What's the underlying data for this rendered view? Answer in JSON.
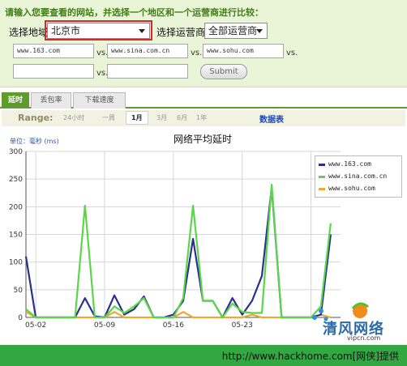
{
  "form": {
    "intro": "请输入您要查看的网站，并选择一个地区和一个运营商进行比较：",
    "region_label": "选择地域",
    "region_value": "北京市",
    "isp_label": "选择运营商：",
    "isp_value": "全部运营商",
    "sites": [
      "www.163.com",
      "www.sina.com.cn",
      "www.sohu.com",
      "",
      ""
    ],
    "vs_label": "vs.",
    "submit_label": "Submit"
  },
  "tabs": [
    {
      "label": "延时",
      "active": true
    },
    {
      "label": "丢包率",
      "active": false
    },
    {
      "label": "下载速度",
      "active": false
    }
  ],
  "range": {
    "label": "Range:",
    "options": [
      "24小时",
      "一周",
      "1月",
      "3月",
      "6月",
      "1年"
    ],
    "selected": "1月",
    "data_table_link": "数据表"
  },
  "chart": {
    "title": "网络平均延时",
    "unit_label": "单位：毫秒 (ms)"
  },
  "chart_data": {
    "type": "line",
    "title": "网络平均延时",
    "ylabel": "单位：毫秒 (ms)",
    "ylim": [
      0,
      300
    ],
    "yticks": [
      0,
      50,
      100,
      150,
      200,
      250,
      300
    ],
    "xlim": [
      0,
      32
    ],
    "xticks": [
      {
        "x": 1,
        "label": "05-02"
      },
      {
        "x": 8,
        "label": "05-09"
      },
      {
        "x": 15,
        "label": "05-16"
      },
      {
        "x": 22,
        "label": "05-23"
      },
      {
        "x": 29,
        "label": ""
      }
    ],
    "grid": true,
    "legend_position": "top-right",
    "series": [
      {
        "name": "www.163.com",
        "color": "#2b2f8f",
        "x": [
          0,
          1,
          2,
          3,
          4,
          5,
          6,
          7,
          8,
          9,
          10,
          11,
          12,
          13,
          14,
          15,
          16,
          17,
          18,
          19,
          20,
          21,
          22,
          23,
          24,
          25,
          26,
          27,
          28,
          29,
          30,
          31
        ],
        "values": [
          110,
          0,
          0,
          0,
          0,
          0,
          35,
          2,
          0,
          40,
          5,
          15,
          38,
          0,
          0,
          5,
          30,
          142,
          30,
          30,
          0,
          35,
          5,
          30,
          75,
          235,
          0,
          0,
          0,
          0,
          5,
          150
        ]
      },
      {
        "name": "www.sina.com.cn",
        "color": "#5ad64a",
        "x": [
          0,
          1,
          2,
          3,
          4,
          5,
          6,
          7,
          8,
          9,
          10,
          11,
          12,
          13,
          14,
          15,
          16,
          17,
          18,
          19,
          20,
          21,
          22,
          23,
          24,
          25,
          26,
          27,
          28,
          29,
          30,
          31
        ],
        "values": [
          15,
          0,
          0,
          0,
          0,
          0,
          202,
          0,
          0,
          20,
          8,
          20,
          35,
          0,
          0,
          0,
          35,
          202,
          30,
          30,
          0,
          25,
          10,
          8,
          8,
          240,
          0,
          0,
          0,
          0,
          20,
          170
        ]
      },
      {
        "name": "www.sohu.com",
        "color": "#f0a830",
        "x": [
          0,
          1,
          2,
          3,
          4,
          5,
          6,
          7,
          8,
          9,
          10,
          11,
          12,
          13,
          14,
          15,
          16,
          17,
          18,
          19,
          20,
          21,
          22,
          23,
          24,
          25,
          26,
          27,
          28,
          29,
          30,
          31
        ],
        "values": [
          10,
          0,
          0,
          0,
          0,
          0,
          0,
          0,
          0,
          10,
          0,
          0,
          0,
          0,
          0,
          0,
          10,
          0,
          0,
          0,
          0,
          0,
          0,
          5,
          0,
          0,
          0,
          0,
          0,
          0,
          5,
          0
        ]
      }
    ]
  },
  "watermark": {
    "brand": "清风网络",
    "sub": "vipcn.com"
  },
  "footer": {
    "text": "http://www.hackhome.com[网侠]提供"
  }
}
